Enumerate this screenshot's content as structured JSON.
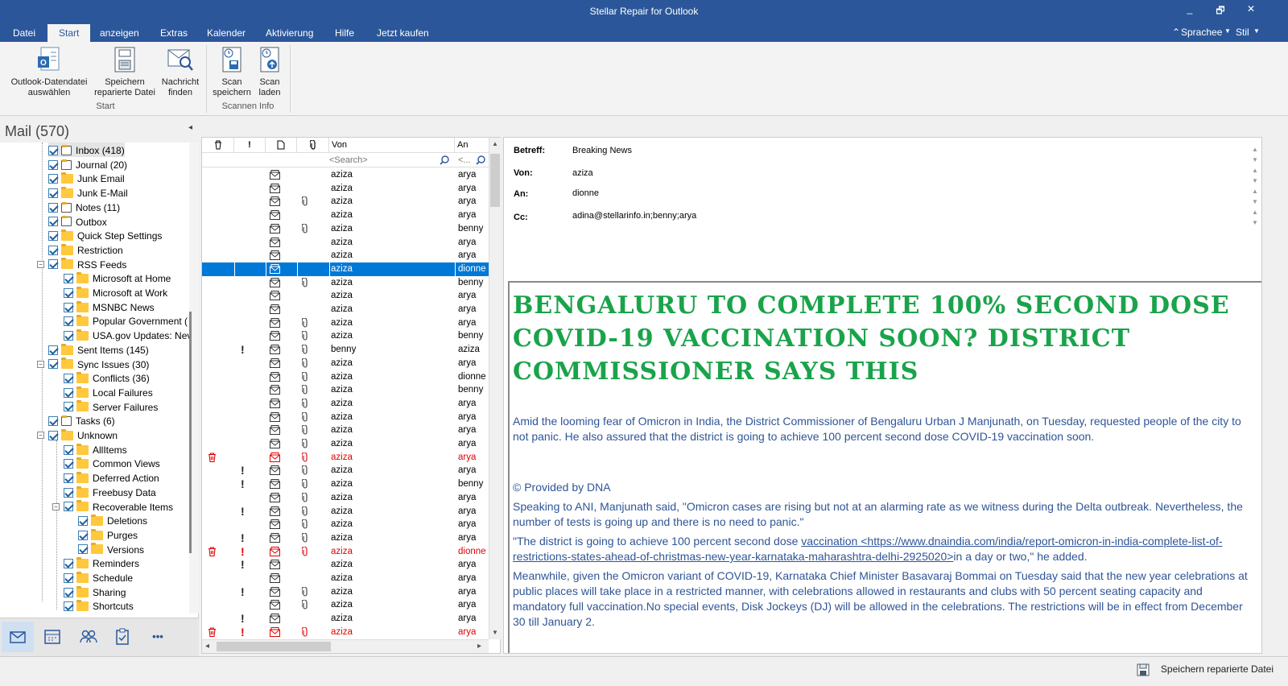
{
  "window": {
    "title": "Stellar Repair for Outlook",
    "controls": [
      "_",
      "🗗",
      "✕"
    ]
  },
  "menu": {
    "tabs": [
      "Datei",
      "Start",
      "anzeigen",
      "Extras",
      "Kalender",
      "Aktivierung",
      "Hilfe",
      "Jetzt kaufen"
    ],
    "active": "Start",
    "sprache": "Sprachee",
    "stil": "Stil"
  },
  "ribbon": {
    "buttons": [
      {
        "line1": "Outlook-Datendatei",
        "line2": "auswählen",
        "icon": "outlook-file-icon"
      },
      {
        "line1": "Speichern",
        "line2": "reparierte Datei",
        "icon": "save-file-icon"
      },
      {
        "line1": "Nachricht",
        "line2": "finden",
        "icon": "find-message-icon"
      },
      {
        "line1": "Scan",
        "line2": "speichern",
        "icon": "scan-save-icon"
      },
      {
        "line1": "Scan",
        "line2": "laden",
        "icon": "scan-load-icon"
      }
    ],
    "groups": [
      "Start",
      "Scannen Info"
    ]
  },
  "mail": {
    "title": "Mail (570)",
    "collapse": "◂"
  },
  "tree": [
    {
      "label": "Inbox (418)",
      "level": 0,
      "icon": "inbox-icon"
    },
    {
      "label": "Journal (20)",
      "level": 0,
      "icon": "journal-icon"
    },
    {
      "label": "Junk Email",
      "level": 0,
      "icon": "folder-icon"
    },
    {
      "label": "Junk E-Mail",
      "level": 0,
      "icon": "folder-icon"
    },
    {
      "label": "Notes (11)",
      "level": 0,
      "icon": "notes-icon"
    },
    {
      "label": "Outbox",
      "level": 0,
      "icon": "outbox-icon"
    },
    {
      "label": "Quick Step Settings",
      "level": 0,
      "icon": "folder-icon"
    },
    {
      "label": "Restriction",
      "level": 0,
      "icon": "folder-icon"
    },
    {
      "label": "RSS Feeds",
      "level": 0,
      "icon": "folder-icon",
      "expander": "⊟"
    },
    {
      "label": "Microsoft at Home",
      "level": 1,
      "icon": "folder-icon"
    },
    {
      "label": "Microsoft at Work",
      "level": 1,
      "icon": "folder-icon"
    },
    {
      "label": "MSNBC News",
      "level": 1,
      "icon": "folder-icon"
    },
    {
      "label": "Popular Government (",
      "level": 1,
      "icon": "folder-icon"
    },
    {
      "label": "USA.gov Updates: Nev",
      "level": 1,
      "icon": "folder-icon"
    },
    {
      "label": "Sent Items (145)",
      "level": 0,
      "icon": "folder-icon"
    },
    {
      "label": "Sync Issues (30)",
      "level": 0,
      "icon": "folder-icon",
      "expander": "⊟"
    },
    {
      "label": "Conflicts (36)",
      "level": 1,
      "icon": "folder-icon"
    },
    {
      "label": "Local Failures",
      "level": 1,
      "icon": "folder-icon"
    },
    {
      "label": "Server Failures",
      "level": 1,
      "icon": "folder-icon"
    },
    {
      "label": "Tasks (6)",
      "level": 0,
      "icon": "tasks-icon"
    },
    {
      "label": "Unknown",
      "level": 0,
      "icon": "folder-icon",
      "expander": "⊟"
    },
    {
      "label": "AllItems",
      "level": 1,
      "icon": "folder-icon"
    },
    {
      "label": "Common Views",
      "level": 1,
      "icon": "folder-icon"
    },
    {
      "label": "Deferred Action",
      "level": 1,
      "icon": "folder-icon"
    },
    {
      "label": "Freebusy Data",
      "level": 1,
      "icon": "folder-icon"
    },
    {
      "label": "Recoverable Items",
      "level": 1,
      "icon": "folder-icon",
      "expander": "⊟"
    },
    {
      "label": "Deletions",
      "level": 2,
      "icon": "folder-icon"
    },
    {
      "label": "Purges",
      "level": 2,
      "icon": "folder-icon"
    },
    {
      "label": "Versions",
      "level": 2,
      "icon": "folder-icon"
    },
    {
      "label": "Reminders",
      "level": 1,
      "icon": "folder-icon"
    },
    {
      "label": "Schedule",
      "level": 1,
      "icon": "folder-icon"
    },
    {
      "label": "Sharing",
      "level": 1,
      "icon": "folder-icon"
    },
    {
      "label": "Shortcuts",
      "level": 1,
      "icon": "folder-icon"
    }
  ],
  "nav": [
    "mail-icon",
    "calendar-icon",
    "contacts-icon",
    "tasks-icon",
    "more-icon"
  ],
  "nav_more": "•••",
  "list": {
    "columns": {
      "von": "Von",
      "an": "An"
    },
    "search_placeholder": "<Search>",
    "search_an_placeholder": "<...",
    "rows": [
      {
        "von": "aziza",
        "an": "arya",
        "att": false,
        "imp": false,
        "del": false
      },
      {
        "von": "aziza",
        "an": "arya",
        "att": false,
        "imp": false,
        "del": false
      },
      {
        "von": "aziza",
        "an": "arya",
        "att": true,
        "imp": false,
        "del": false
      },
      {
        "von": "aziza",
        "an": "arya",
        "att": false,
        "imp": false,
        "del": false
      },
      {
        "von": "aziza",
        "an": "benny",
        "att": true,
        "imp": false,
        "del": false
      },
      {
        "von": "aziza",
        "an": "arya",
        "att": false,
        "imp": false,
        "del": false
      },
      {
        "von": "aziza",
        "an": "arya",
        "att": false,
        "imp": false,
        "del": false
      },
      {
        "von": "aziza",
        "an": "dionne",
        "att": false,
        "imp": false,
        "del": false,
        "selected": true
      },
      {
        "von": "aziza",
        "an": "benny",
        "att": true,
        "imp": false,
        "del": false
      },
      {
        "von": "aziza",
        "an": "arya",
        "att": false,
        "imp": false,
        "del": false
      },
      {
        "von": "aziza",
        "an": "arya",
        "att": false,
        "imp": false,
        "del": false
      },
      {
        "von": "aziza",
        "an": "arya",
        "att": true,
        "imp": false,
        "del": false
      },
      {
        "von": "aziza",
        "an": "benny",
        "att": true,
        "imp": false,
        "del": false
      },
      {
        "von": "benny",
        "an": "aziza",
        "att": true,
        "imp": true,
        "del": false
      },
      {
        "von": "aziza",
        "an": "arya",
        "att": true,
        "imp": false,
        "del": false
      },
      {
        "von": "aziza",
        "an": "dionne",
        "att": true,
        "imp": false,
        "del": false
      },
      {
        "von": "aziza",
        "an": "benny",
        "att": true,
        "imp": false,
        "del": false
      },
      {
        "von": "aziza",
        "an": "arya",
        "att": true,
        "imp": false,
        "del": false
      },
      {
        "von": "aziza",
        "an": "arya",
        "att": true,
        "imp": false,
        "del": false
      },
      {
        "von": "aziza",
        "an": "arya",
        "att": true,
        "imp": false,
        "del": false
      },
      {
        "von": "aziza",
        "an": "arya",
        "att": true,
        "imp": false,
        "del": false
      },
      {
        "von": "aziza",
        "an": "arya",
        "att": true,
        "imp": false,
        "del": true
      },
      {
        "von": "aziza",
        "an": "arya",
        "att": true,
        "imp": true,
        "del": false
      },
      {
        "von": "aziza",
        "an": "benny",
        "att": true,
        "imp": true,
        "del": false
      },
      {
        "von": "aziza",
        "an": "arya",
        "att": true,
        "imp": false,
        "del": false
      },
      {
        "von": "aziza",
        "an": "arya",
        "att": true,
        "imp": true,
        "del": false
      },
      {
        "von": "aziza",
        "an": "arya",
        "att": true,
        "imp": false,
        "del": false
      },
      {
        "von": "aziza",
        "an": "arya",
        "att": true,
        "imp": true,
        "del": false
      },
      {
        "von": "aziza",
        "an": "dionne",
        "att": true,
        "imp": true,
        "del": true
      },
      {
        "von": "aziza",
        "an": "arya",
        "att": false,
        "imp": true,
        "del": false
      },
      {
        "von": "aziza",
        "an": "arya",
        "att": false,
        "imp": false,
        "del": false
      },
      {
        "von": "aziza",
        "an": "arya",
        "att": true,
        "imp": true,
        "del": false
      },
      {
        "von": "aziza",
        "an": "arya",
        "att": true,
        "imp": false,
        "del": false
      },
      {
        "von": "aziza",
        "an": "arya",
        "att": false,
        "imp": true,
        "del": false
      },
      {
        "von": "aziza",
        "an": "arya",
        "att": true,
        "imp": true,
        "del": true
      }
    ]
  },
  "message": {
    "labels": {
      "betreff": "Betreff:",
      "von": "Von:",
      "an": "An:",
      "cc": "Cc:"
    },
    "betreff": "Breaking News",
    "von": "aziza",
    "an": "dionne",
    "cc": "adina@stellarinfo.in;benny;arya",
    "headline": "Bengaluru to complete 100% second dose COVID-19 vaccination soon? District Commissioner says this",
    "p1": "Amid the looming fear of Omicron in India, the District Commissioner of Bengaluru Urban J Manjunath, on Tuesday, requested people of the city to not panic. He also assured that the district is going to achieve 100 percent second dose COVID-19 vaccination soon.",
    "p2": "© Provided by DNA",
    "p3": "Speaking to ANI, Manjunath said, \"Omicron cases are rising but not at an alarming rate as we witness during the Delta outbreak. Nevertheless, the number of tests is going up and there is no need to panic.\"",
    "p4_pre": "\"The district is going to achieve 100 percent second dose ",
    "p4_link": "vaccination  <https://www.dnaindia.com/india/report-omicron-in-india-complete-list-of-restrictions-states-ahead-of-christmas-new-year-karnataka-maharashtra-delhi-2925020>",
    "p4_post": "in a day or two,\" he added.",
    "p5": "Meanwhile, given the Omicron variant of COVID-19, Karnataka Chief Minister Basavaraj Bommai on Tuesday said that the new year celebrations at public places will take place in a restricted manner, with celebrations allowed in restaurants and clubs with 50 percent seating capacity and mandatory full vaccination.No special events, Disk Jockeys (DJ) will be allowed in the celebrations. The restrictions will be in effect from December 30 till January 2."
  },
  "status": {
    "text": "Speichern reparierte Datei"
  },
  "colors": {
    "titlebar": "#2b579a",
    "selection": "#0078d7",
    "headline": "#1aa34a",
    "body_text": "#2f5597",
    "deleted": "#e00000"
  }
}
